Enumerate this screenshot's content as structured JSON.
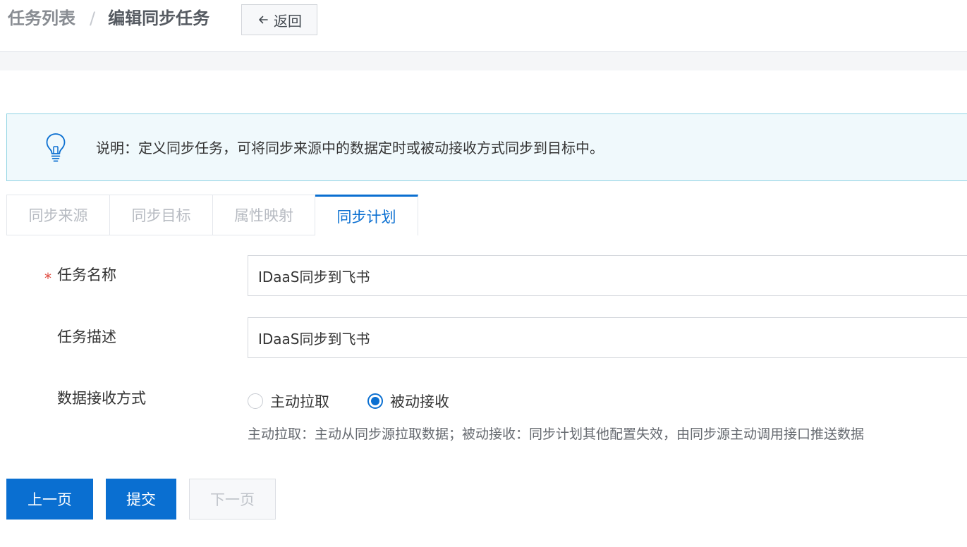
{
  "header": {
    "breadcrumb_parent": "任务列表",
    "breadcrumb_separator": "/",
    "breadcrumb_current": "编辑同步任务",
    "back_label": "返回"
  },
  "notice": {
    "icon": "lightbulb-icon",
    "text": "说明：定义同步任务，可将同步来源中的数据定时或被动接收方式同步到目标中。"
  },
  "tabs": [
    {
      "label": "同步来源",
      "active": false
    },
    {
      "label": "同步目标",
      "active": false
    },
    {
      "label": "属性映射",
      "active": false
    },
    {
      "label": "同步计划",
      "active": true
    }
  ],
  "form": {
    "required_mark": "*",
    "task_name": {
      "label": "任务名称",
      "value": "IDaaS同步到飞书"
    },
    "task_desc": {
      "label": "任务描述",
      "value": "IDaaS同步到飞书"
    },
    "receive_mode": {
      "label": "数据接收方式",
      "options": [
        {
          "label": "主动拉取",
          "checked": false
        },
        {
          "label": "被动接收",
          "checked": true
        }
      ],
      "hint": "主动拉取：主动从同步源拉取数据；被动接收：同步计划其他配置失效，由同步源主动调用接口推送数据"
    }
  },
  "buttons": {
    "prev": "上一页",
    "submit": "提交",
    "next": "下一页"
  },
  "colors": {
    "primary": "#0a6fd1",
    "notice_bg": "#f0f9fc",
    "notice_border": "#8fd3e3",
    "required": "#e0483d"
  }
}
